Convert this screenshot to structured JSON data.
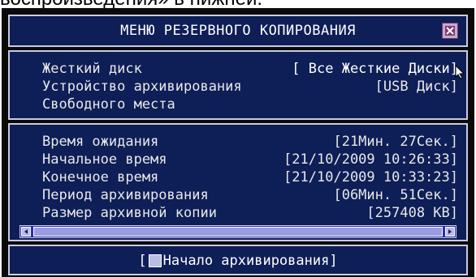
{
  "caption": "воспроизведения» в нижней.",
  "window": {
    "title": "МЕНЮ РЕЗЕРВНОГО КОПИРОВАНИЯ"
  },
  "settings": [
    {
      "label": "Жесткий диск",
      "value": "[ Все Жесткие Диски]"
    },
    {
      "label": "Устройство архивирования",
      "value": "[USB Диск]"
    },
    {
      "label": "Свободного места",
      "value": ""
    }
  ],
  "info": [
    {
      "label": "Время ожидания",
      "value": "[21Мин. 27Сек.]"
    },
    {
      "label": "Начальное время",
      "value": "[21/10/2009 10:26:33]"
    },
    {
      "label": "Конечное время",
      "value": "[21/10/2009 10:33:23]"
    },
    {
      "label": "Период архивирования",
      "value": "[06Мин. 51Сек.]"
    },
    {
      "label": "Размер архивной копии",
      "value": "[257408 KB]"
    }
  ],
  "action": {
    "open_bracket": "[",
    "label": "Начало архивирования",
    "close_bracket": "]"
  },
  "icons": [
    "close-icon",
    "hdd-icon",
    "mouse-pointer-icon",
    "scroll-left-icon",
    "scroll-right-icon",
    "start-icon"
  ],
  "colors": {
    "panel": "#0e1e56",
    "border": "#c9cbe0",
    "text": "#e8e8e8"
  }
}
